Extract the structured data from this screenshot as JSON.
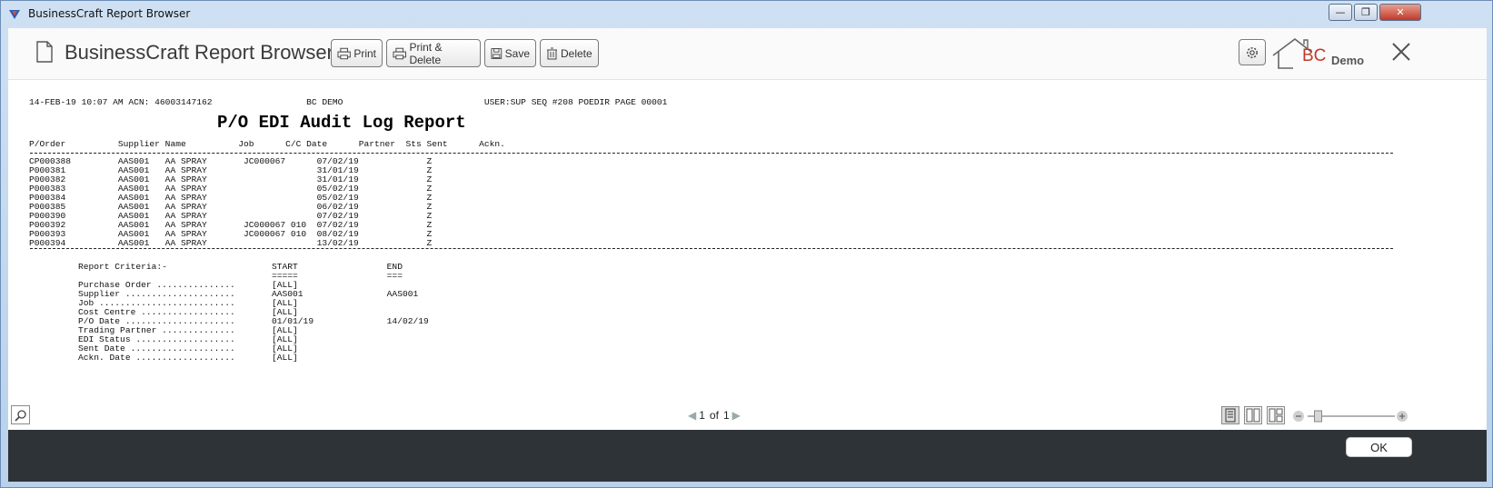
{
  "window": {
    "title": "BusinessCraft Report Browser",
    "min_glyph": "—",
    "max_glyph": "❐",
    "close_glyph": "✕"
  },
  "toolbar": {
    "app_title": "BusinessCraft Report Browser",
    "print_label": "Print",
    "print_delete_label": "Print & Delete",
    "save_label": "Save",
    "delete_label": "Delete",
    "logo_text": "BC",
    "demo_label": "Demo"
  },
  "report": {
    "header_line": "14-FEB-19 10:07 AM ACN: 46003147162                  BC DEMO                           USER:SUP SEQ #208 POEDIR PAGE 00001",
    "title": "P/O EDI Audit Log Report",
    "column_header": "P/Order          Supplier Name          Job      C/C Date      Partner  Sts Sent      Ackn.",
    "rows": [
      "CP000388         AAS001   AA SPRAY       JC000067      07/02/19             Z",
      "P000381          AAS001   AA SPRAY                     31/01/19             Z",
      "P000382          AAS001   AA SPRAY                     31/01/19             Z",
      "P000383          AAS001   AA SPRAY                     05/02/19             Z",
      "P000384          AAS001   AA SPRAY                     05/02/19             Z",
      "P000385          AAS001   AA SPRAY                     06/02/19             Z",
      "P000390          AAS001   AA SPRAY                     07/02/19             Z",
      "P000392          AAS001   AA SPRAY       JC000067 010  07/02/19             Z",
      "P000393          AAS001   AA SPRAY       JC000067 010  08/02/19             Z",
      "P000394          AAS001   AA SPRAY                     13/02/19             Z"
    ],
    "criteria": [
      "Report Criteria:-                    START                 END",
      "                                     =====                 ===",
      "Purchase Order ...............       [ALL]",
      "Supplier .....................       AAS001                AAS001",
      "Job ..........................       [ALL]",
      "Cost Centre ..................       [ALL]",
      "P/O Date .....................       01/01/19              14/02/19",
      "Trading Partner ..............       [ALL]",
      "EDI Status ...................       [ALL]",
      "Sent Date ....................       [ALL]",
      "Ackn. Date ...................       [ALL]"
    ]
  },
  "pager": {
    "current": "1",
    "of_label": "of",
    "total": "1"
  },
  "zoom": {
    "level": 0.12
  },
  "footer": {
    "ok_label": "OK"
  },
  "colors": {
    "accent": "#c0392b",
    "footer_bg": "#2e3338"
  }
}
